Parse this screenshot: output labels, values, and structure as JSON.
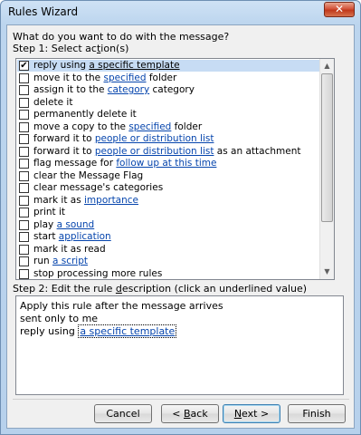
{
  "window": {
    "title": "Rules Wizard",
    "close_glyph": "✕"
  },
  "prompt": "What do you want to do with the message?",
  "step1": {
    "pre": "Step 1: Select ac",
    "accel": "t",
    "post": "ion(s)"
  },
  "actions": [
    {
      "checked": true,
      "pre": "reply using ",
      "link": "a specific template",
      "post": ""
    },
    {
      "checked": false,
      "pre": "move it to the ",
      "link": "specified",
      "post": " folder"
    },
    {
      "checked": false,
      "pre": "assign it to the ",
      "link": "category",
      "post": " category"
    },
    {
      "checked": false,
      "pre": "delete it",
      "link": "",
      "post": ""
    },
    {
      "checked": false,
      "pre": "permanently delete it",
      "link": "",
      "post": ""
    },
    {
      "checked": false,
      "pre": "move a copy to the ",
      "link": "specified",
      "post": " folder"
    },
    {
      "checked": false,
      "pre": "forward it to ",
      "link": "people or distribution list",
      "post": ""
    },
    {
      "checked": false,
      "pre": "forward it to ",
      "link": "people or distribution list",
      "post": " as an attachment"
    },
    {
      "checked": false,
      "pre": "flag message for ",
      "link": "follow up at this time",
      "post": ""
    },
    {
      "checked": false,
      "pre": "clear the Message Flag",
      "link": "",
      "post": ""
    },
    {
      "checked": false,
      "pre": "clear message's categories",
      "link": "",
      "post": ""
    },
    {
      "checked": false,
      "pre": "mark it as ",
      "link": "importance",
      "post": ""
    },
    {
      "checked": false,
      "pre": "print it",
      "link": "",
      "post": ""
    },
    {
      "checked": false,
      "pre": "play ",
      "link": "a sound",
      "post": ""
    },
    {
      "checked": false,
      "pre": "start ",
      "link": "application",
      "post": ""
    },
    {
      "checked": false,
      "pre": "mark it as read",
      "link": "",
      "post": ""
    },
    {
      "checked": false,
      "pre": "run ",
      "link": "a script",
      "post": ""
    },
    {
      "checked": false,
      "pre": "stop processing more rules",
      "link": "",
      "post": ""
    }
  ],
  "step2": {
    "pre": "Step 2: Edit the rule ",
    "accel": "d",
    "post": "escription (click an underlined value)"
  },
  "description": {
    "line1": "Apply this rule after the message arrives",
    "line2": "sent only to me",
    "line3_pre": "reply using ",
    "line3_link": "a specific template"
  },
  "buttons": {
    "cancel": "Cancel",
    "back": {
      "pre": "< ",
      "accel": "B",
      "post": "ack"
    },
    "next": {
      "accel": "N",
      "post": "ext >"
    },
    "finish": "Finish"
  },
  "scroll": {
    "up": "▲",
    "down": "▼"
  }
}
